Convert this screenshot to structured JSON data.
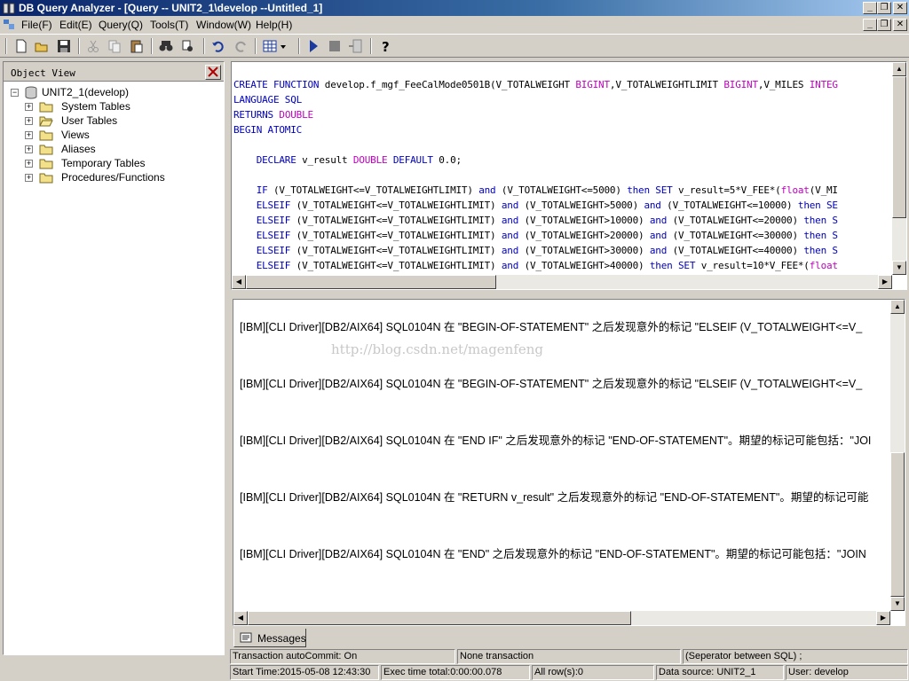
{
  "window": {
    "title": "DB Query Analyzer - [Query -- UNIT2_1\\develop --Untitled_1]",
    "caption_buttons": [
      "minimize-icon",
      "restore-icon",
      "close-icon"
    ]
  },
  "menu": {
    "items": [
      "File(F)",
      "Edit(E)",
      "Query(Q)",
      "Tools(T)",
      "Window(W)",
      "Help(H)"
    ]
  },
  "toolbar": {
    "buttons": [
      "new-icon",
      "open-icon",
      "save-icon",
      "cut-icon",
      "copy-icon",
      "paste-icon",
      "find-icon",
      "replace-icon",
      "undo-icon",
      "redo-icon",
      "grid-icon",
      "execute-icon",
      "stop-icon",
      "plan-icon",
      "help-icon"
    ]
  },
  "object_view": {
    "title": "Object View",
    "root": "UNIT2_1(develop)",
    "children": [
      "System Tables",
      "User Tables",
      "Views",
      "Aliases",
      "Temporary Tables",
      "Procedures/Functions"
    ]
  },
  "editor": {
    "lines": [
      [
        {
          "t": "CREATE FUNCTION ",
          "c": "kw"
        },
        {
          "t": "develop.f_mgf_FeeCalMode0501B(V_TOTALWEIGHT ",
          "c": ""
        },
        {
          "t": "BIGINT",
          "c": "ty"
        },
        {
          "t": ",V_TOTALWEIGHTLIMIT ",
          "c": ""
        },
        {
          "t": "BIGINT",
          "c": "ty"
        },
        {
          "t": ",V_MILES ",
          "c": ""
        },
        {
          "t": "INTEG",
          "c": "ty"
        }
      ],
      [
        {
          "t": "LANGUAGE SQL",
          "c": "kw"
        }
      ],
      [
        {
          "t": "RETURNS ",
          "c": "kw"
        },
        {
          "t": "DOUBLE",
          "c": "ty"
        }
      ],
      [
        {
          "t": "BEGIN ATOMIC",
          "c": "kw"
        }
      ],
      [],
      [
        {
          "t": "    DECLARE ",
          "c": "kw"
        },
        {
          "t": "v_result ",
          "c": ""
        },
        {
          "t": "DOUBLE ",
          "c": "ty"
        },
        {
          "t": "DEFAULT ",
          "c": "kw"
        },
        {
          "t": "0.0;",
          "c": ""
        }
      ],
      [],
      [
        {
          "t": "    IF ",
          "c": "kw"
        },
        {
          "t": "(V_TOTALWEIGHT<=V_TOTALWEIGHTLIMIT) ",
          "c": ""
        },
        {
          "t": "and ",
          "c": "kw"
        },
        {
          "t": "(V_TOTALWEIGHT<=5000) ",
          "c": ""
        },
        {
          "t": "then SET ",
          "c": "kw"
        },
        {
          "t": "v_result=5*V_FEE*(",
          "c": ""
        },
        {
          "t": "float",
          "c": "ty"
        },
        {
          "t": "(V_MI",
          "c": ""
        }
      ],
      [
        {
          "t": "    ELSEIF ",
          "c": "kw"
        },
        {
          "t": "(V_TOTALWEIGHT<=V_TOTALWEIGHTLIMIT) ",
          "c": ""
        },
        {
          "t": "and ",
          "c": "kw"
        },
        {
          "t": "(V_TOTALWEIGHT>5000) ",
          "c": ""
        },
        {
          "t": "and ",
          "c": "kw"
        },
        {
          "t": "(V_TOTALWEIGHT<=10000) ",
          "c": ""
        },
        {
          "t": "then SE",
          "c": "kw"
        }
      ],
      [
        {
          "t": "    ELSEIF ",
          "c": "kw"
        },
        {
          "t": "(V_TOTALWEIGHT<=V_TOTALWEIGHTLIMIT) ",
          "c": ""
        },
        {
          "t": "and ",
          "c": "kw"
        },
        {
          "t": "(V_TOTALWEIGHT>10000) ",
          "c": ""
        },
        {
          "t": "and ",
          "c": "kw"
        },
        {
          "t": "(V_TOTALWEIGHT<=20000) ",
          "c": ""
        },
        {
          "t": "then S",
          "c": "kw"
        }
      ],
      [
        {
          "t": "    ELSEIF ",
          "c": "kw"
        },
        {
          "t": "(V_TOTALWEIGHT<=V_TOTALWEIGHTLIMIT) ",
          "c": ""
        },
        {
          "t": "and ",
          "c": "kw"
        },
        {
          "t": "(V_TOTALWEIGHT>20000) ",
          "c": ""
        },
        {
          "t": "and ",
          "c": "kw"
        },
        {
          "t": "(V_TOTALWEIGHT<=30000) ",
          "c": ""
        },
        {
          "t": "then S",
          "c": "kw"
        }
      ],
      [
        {
          "t": "    ELSEIF ",
          "c": "kw"
        },
        {
          "t": "(V_TOTALWEIGHT<=V_TOTALWEIGHTLIMIT) ",
          "c": ""
        },
        {
          "t": "and ",
          "c": "kw"
        },
        {
          "t": "(V_TOTALWEIGHT>30000) ",
          "c": ""
        },
        {
          "t": "and ",
          "c": "kw"
        },
        {
          "t": "(V_TOTALWEIGHT<=40000) ",
          "c": ""
        },
        {
          "t": "then S",
          "c": "kw"
        }
      ],
      [
        {
          "t": "    ELSEIF ",
          "c": "kw"
        },
        {
          "t": "(V_TOTALWEIGHT<=V_TOTALWEIGHTLIMIT) ",
          "c": ""
        },
        {
          "t": "and ",
          "c": "kw"
        },
        {
          "t": "(V_TOTALWEIGHT>40000) ",
          "c": ""
        },
        {
          "t": "then SET ",
          "c": "kw"
        },
        {
          "t": "v_result=10*V_FEE*(",
          "c": ""
        },
        {
          "t": "float",
          "c": "ty"
        }
      ]
    ]
  },
  "messages": {
    "items": [
      "[IBM][CLI Driver][DB2/AIX64] SQL0104N  在 \"BEGIN-OF-STATEMENT\" 之后发现意外的标记 \"ELSEIF (V_TOTALWEIGHT<=V_",
      "[IBM][CLI Driver][DB2/AIX64] SQL0104N  在 \"BEGIN-OF-STATEMENT\" 之后发现意外的标记 \"ELSEIF (V_TOTALWEIGHT<=V_",
      "[IBM][CLI Driver][DB2/AIX64] SQL0104N  在 \"END IF\" 之后发现意外的标记 \"END-OF-STATEMENT\"。期望的标记可能包括：\"JOI",
      "[IBM][CLI Driver][DB2/AIX64] SQL0104N  在 \"RETURN v_result\" 之后发现意外的标记 \"END-OF-STATEMENT\"。期望的标记可能",
      "[IBM][CLI Driver][DB2/AIX64] SQL0104N  在 \"END\" 之后发现意外的标记 \"END-OF-STATEMENT\"。期望的标记可能包括：\"JOIN"
    ],
    "watermark": "http://blog.csdn.net/magenfeng",
    "tab_label": "Messages"
  },
  "status": {
    "autocommit": "Transaction autoCommit: On",
    "transaction": "None transaction",
    "separator": "(Seperator between SQL)   ;",
    "start_time": "Start Time:2015-05-08 12:43:30",
    "exec_time": "Exec time total:0:00:00.078",
    "rows": "All row(s):0",
    "data_source": "Data source: UNIT2_1",
    "user": "User: develop"
  }
}
